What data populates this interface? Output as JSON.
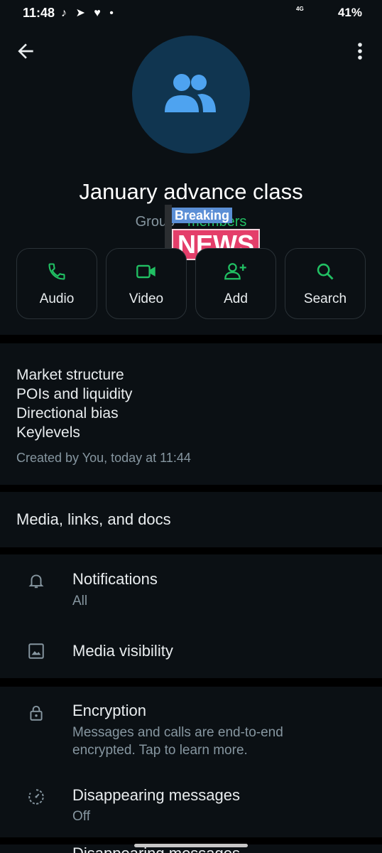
{
  "status_bar": {
    "time": "11:48",
    "left_icons": "♪ ➤ ♥ •",
    "network": "4G",
    "battery_text": "41%"
  },
  "header": {
    "back_icon": "arrow-left-icon",
    "menu_icon": "more-vert-icon",
    "avatar_icon": "group-icon",
    "group_name": "January advance class",
    "subtitle_prefix": "Group ·",
    "subtitle_members": "members"
  },
  "sticker": {
    "line1": "Breaking",
    "line2": "NEWS"
  },
  "actions": [
    {
      "label": "Audio",
      "icon": "phone-icon"
    },
    {
      "label": "Video",
      "icon": "videocam-icon"
    },
    {
      "label": "Add",
      "icon": "person-add-icon"
    },
    {
      "label": "Search",
      "icon": "search-icon"
    }
  ],
  "description": {
    "lines": [
      "Market structure",
      "POIs and liquidity",
      "Directional bias",
      "Keylevels"
    ],
    "created": "Created by You, today at 11:44"
  },
  "media": {
    "label": "Media, links, and docs"
  },
  "settings": {
    "notifications": {
      "title": "Notifications",
      "value": "All"
    },
    "media_visibility": {
      "title": "Media visibility"
    },
    "encryption": {
      "title": "Encryption",
      "desc": "Messages and calls are end-to-end encrypted. Tap to learn more."
    },
    "disappearing": {
      "title": "Disappearing messages",
      "value": "Off"
    },
    "next_item_partial": "Disappearing messages"
  },
  "colors": {
    "background": "#0b1014",
    "accent_green": "#21c063",
    "avatar_bg": "#103550",
    "avatar_icon": "#4ea3f0"
  }
}
